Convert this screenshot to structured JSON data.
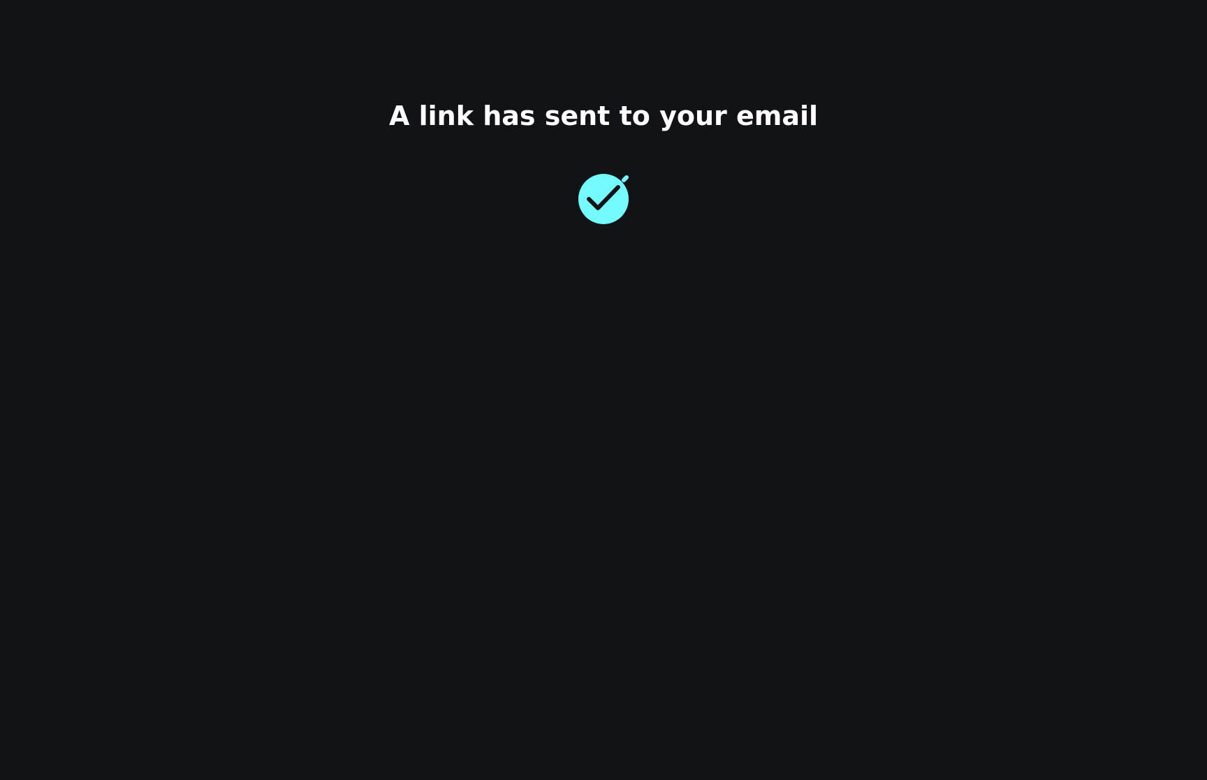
{
  "confirmation": {
    "message": "A link has sent to your email",
    "icon": "check-circle-icon",
    "accent_color": "#74FBFF",
    "text_color": "#FFFFFF",
    "background_color": "#111317"
  }
}
